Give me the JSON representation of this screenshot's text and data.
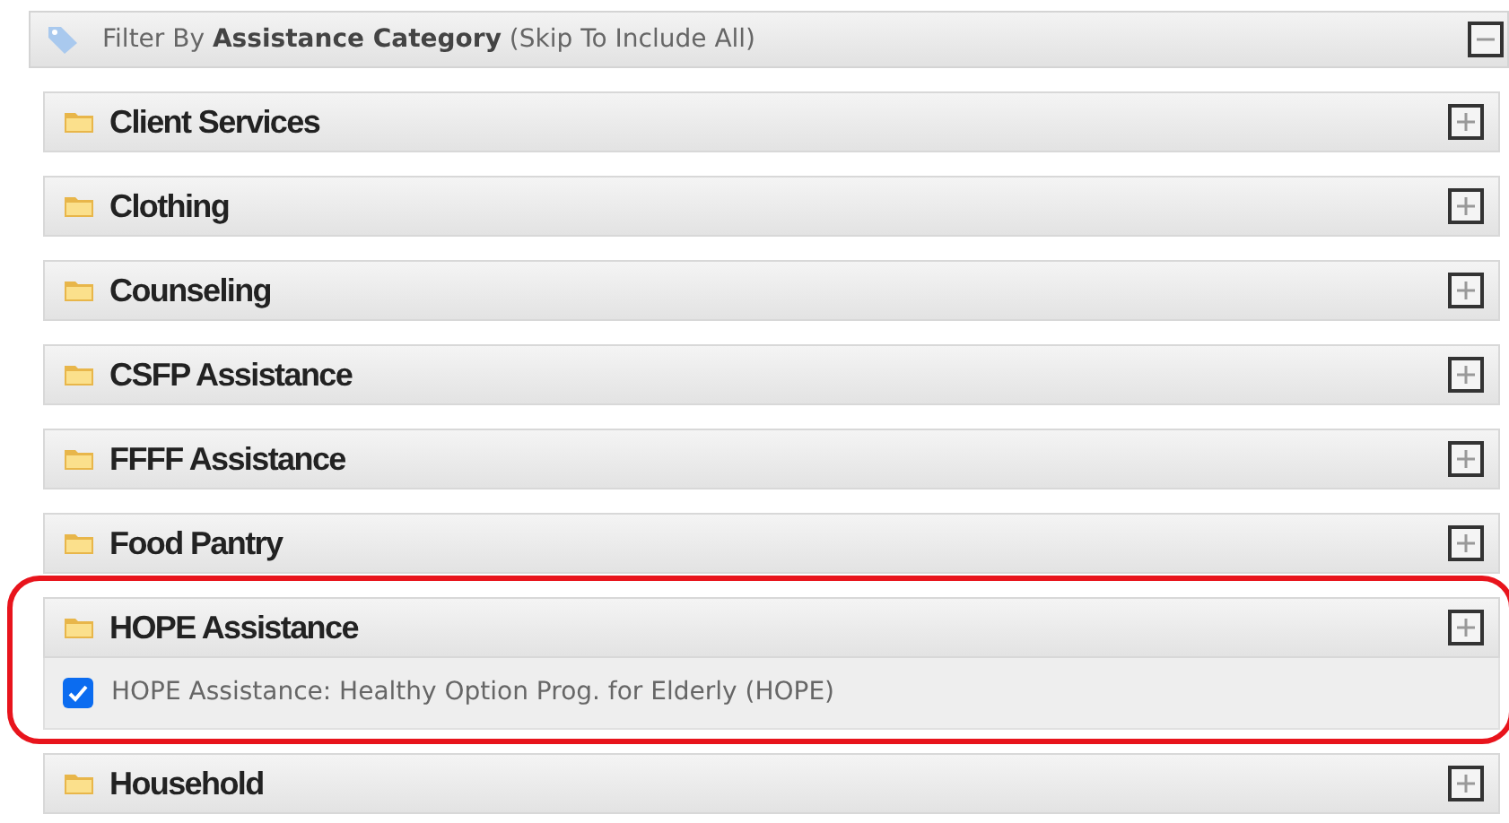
{
  "filter_header": {
    "text": "Filter By **Assistance Category** (Skip To Include All)",
    "expanded": true
  },
  "categories": [
    {
      "name": "Client Services",
      "highlighted": false
    },
    {
      "name": "Clothing",
      "highlighted": false
    },
    {
      "name": "Counseling",
      "highlighted": false
    },
    {
      "name": "CSFP Assistance",
      "highlighted": false
    },
    {
      "name": "FFFF Assistance",
      "highlighted": false
    },
    {
      "name": "Food Pantry",
      "highlighted": false
    },
    {
      "name": "HOPE Assistance",
      "highlighted": true,
      "options": [
        {
          "label": "HOPE Assistance: Healthy Option Prog. for Elderly (HOPE)",
          "checked": true
        }
      ]
    },
    {
      "name": "Household",
      "highlighted": false
    }
  ]
}
